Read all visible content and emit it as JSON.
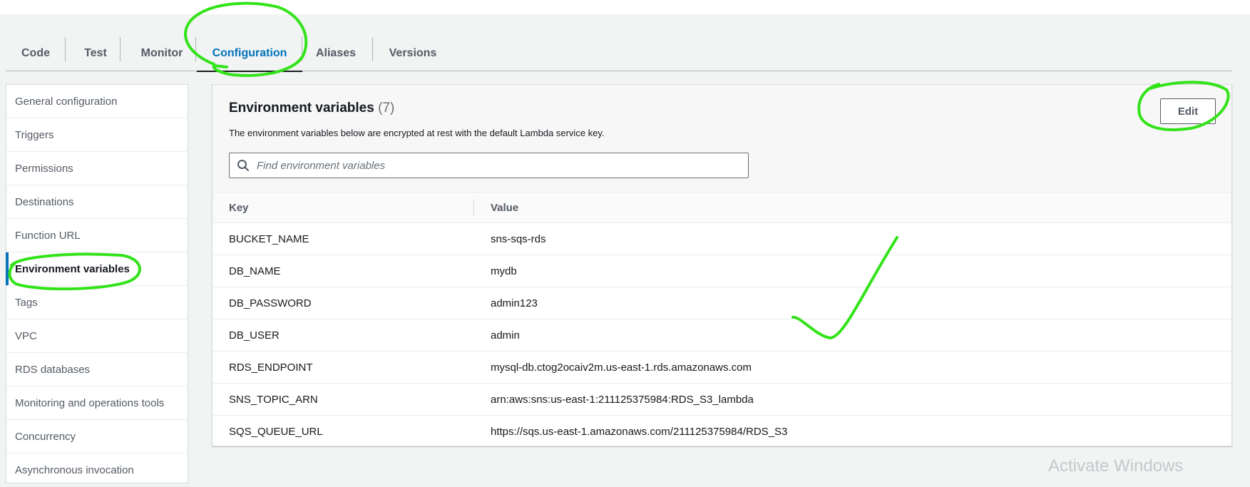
{
  "tabs": [
    {
      "label": "Code",
      "active": false
    },
    {
      "label": "Test",
      "active": false
    },
    {
      "label": "Monitor",
      "active": false
    },
    {
      "label": "Configuration",
      "active": true
    },
    {
      "label": "Aliases",
      "active": false
    },
    {
      "label": "Versions",
      "active": false
    }
  ],
  "sidebar": {
    "items": [
      {
        "label": "General configuration"
      },
      {
        "label": "Triggers"
      },
      {
        "label": "Permissions"
      },
      {
        "label": "Destinations"
      },
      {
        "label": "Function URL"
      },
      {
        "label": "Environment variables",
        "active": true
      },
      {
        "label": "Tags"
      },
      {
        "label": "VPC"
      },
      {
        "label": "RDS databases"
      },
      {
        "label": "Monitoring and operations tools"
      },
      {
        "label": "Concurrency"
      },
      {
        "label": "Asynchronous invocation"
      }
    ]
  },
  "panel": {
    "title": "Environment variables",
    "count": "(7)",
    "description": "The environment variables below are encrypted at rest with the default Lambda service key.",
    "edit_label": "Edit",
    "search_placeholder": "Find environment variables",
    "search_value": ""
  },
  "table": {
    "headers": {
      "key": "Key",
      "value": "Value"
    },
    "rows": [
      {
        "key": "BUCKET_NAME",
        "value": "sns-sqs-rds"
      },
      {
        "key": "DB_NAME",
        "value": "mydb"
      },
      {
        "key": "DB_PASSWORD",
        "value": "admin123"
      },
      {
        "key": "DB_USER",
        "value": "admin"
      },
      {
        "key": "RDS_ENDPOINT",
        "value": "mysql-db.ctog2ocaiv2m.us-east-1.rds.amazonaws.com"
      },
      {
        "key": "SNS_TOPIC_ARN",
        "value": "arn:aws:sns:us-east-1:211125375984:RDS_S3_lambda"
      },
      {
        "key": "SQS_QUEUE_URL",
        "value": "https://sqs.us-east-1.amazonaws.com/211125375984/RDS_S3"
      }
    ]
  },
  "watermark": "Activate Windows",
  "colors": {
    "accent": "#0073bb",
    "annotation": "#33e31a"
  }
}
